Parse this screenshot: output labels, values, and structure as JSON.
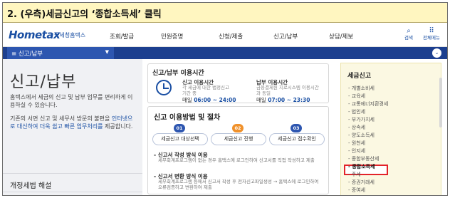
{
  "caption": "2. (우측)세금신고의 ‘종합소득세’ 클릭",
  "header": {
    "logo_main": "Hometax",
    "logo_sub": "국세청홈택스",
    "nav": [
      "조회/발급",
      "민원증명",
      "신청/제출",
      "신고/납부",
      "상담/제보"
    ],
    "util": [
      {
        "icon": "search-icon",
        "label": "검색"
      },
      {
        "icon": "grid-menu-icon",
        "label": "전체메뉴"
      }
    ]
  },
  "crumb": {
    "label": "≡  신고/납부"
  },
  "left": {
    "title": "신고/납부",
    "desc1": "홈택스에서 세금의 신고 및 납부 업무를 편리하게 이용하실 수 있습니다.",
    "desc2_pre": "기존의 서면 신고 및 세무서 방문의 불편을 ",
    "desc2_hl": "인터넷으로 대신하여 더욱 쉽고 빠른 업무처리를",
    "desc2_post": " 제공합니다.",
    "reform": "개정세법 해설"
  },
  "hours": {
    "title": "신고/납부 이용시간",
    "report": {
      "head": "신고 이용시간",
      "desc": "각 세금에 대한 법정신고 기간 중",
      "day_label": "매일",
      "time": "06:00 ~ 24:00"
    },
    "payment": {
      "head": "납부 이용시간",
      "desc": "금융결제원 지로시스템 이용시간과 동일",
      "day_label": "매일",
      "time": "07:00 ~ 23:30"
    }
  },
  "methods": {
    "title": "신고 이용방법 및 절차",
    "steps": [
      {
        "num": "01",
        "label": "세금신고 대상선택",
        "color": "#2d56b0"
      },
      {
        "num": "02",
        "label": "세금신고 진행",
        "color": "#f0912b"
      },
      {
        "num": "03",
        "label": "세금신고 접수확인",
        "color": "#2d56b0"
      }
    ],
    "m1_head": "- 신고서 작성 방식 이용",
    "m1_desc": "세무회계프로그램이 없는 경우 홈택스에 로그인하여 신고서를 직접 작성하고 제출",
    "m2_head": "- 신고서 변환 방식 이용",
    "m2_desc": "세무회계프로그램 등에서 신고서 작성 후 전자신고파일생성 → 홈택스에 로그인하여 오류검증하고 변환하여 제출"
  },
  "tax": {
    "title": "세금신고",
    "items": [
      "- 개별소비세",
      "- 교육세",
      "- 교통에너지환경세",
      "- 법인세",
      "- 부가가치세",
      "- 상속세",
      "- 양도소득세",
      "- 원천세",
      "- 인지세",
      "- 종합부동산세",
      "- 종합소득세",
      "- 주세",
      "- 증권거래세",
      "- 증여세"
    ],
    "highlighted": "- 종합소득세",
    "highlight_color": "#e3232a"
  }
}
